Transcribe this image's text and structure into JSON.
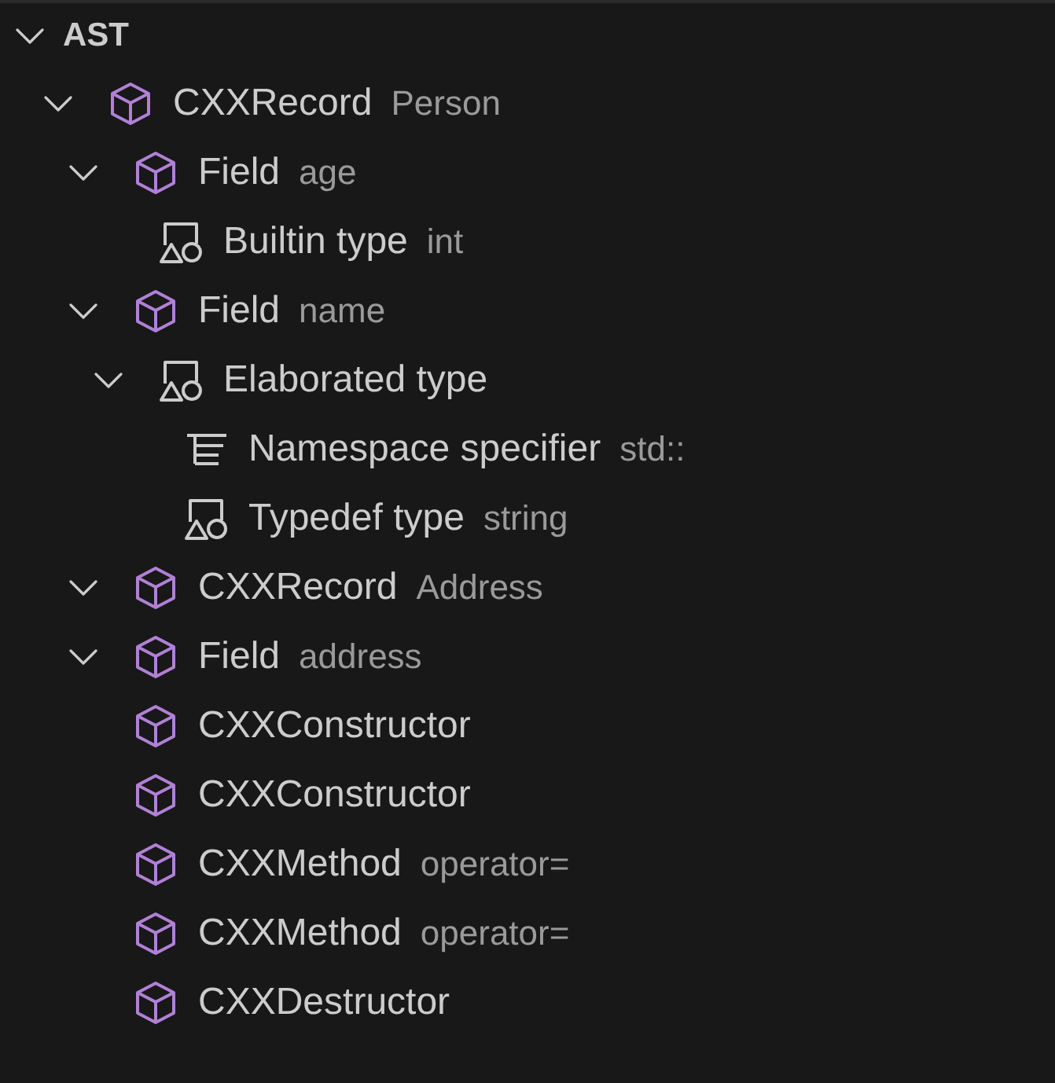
{
  "panel": {
    "title": "AST",
    "expanded": true
  },
  "nodes": [
    {
      "kind": "cube",
      "label": "CXXRecord",
      "detail": "Person",
      "expanded": true,
      "children": [
        {
          "kind": "cube",
          "label": "Field",
          "detail": "age",
          "expanded": true,
          "children": [
            {
              "kind": "shapes",
              "label": "Builtin type",
              "detail": "int"
            }
          ]
        },
        {
          "kind": "cube",
          "label": "Field",
          "detail": "name",
          "expanded": true,
          "children": [
            {
              "kind": "shapes",
              "label": "Elaborated type",
              "expanded": true,
              "children": [
                {
                  "kind": "list",
                  "label": "Namespace specifier",
                  "detail": "std::"
                },
                {
                  "kind": "shapes",
                  "label": "Typedef type",
                  "detail": "string"
                }
              ]
            }
          ]
        },
        {
          "kind": "cube",
          "label": "CXXRecord",
          "detail": "Address",
          "expanded": true
        },
        {
          "kind": "cube",
          "label": "Field",
          "detail": "address",
          "expanded": true
        },
        {
          "kind": "cube",
          "label": "CXXConstructor"
        },
        {
          "kind": "cube",
          "label": "CXXConstructor"
        },
        {
          "kind": "cube",
          "label": "CXXMethod",
          "detail": "operator="
        },
        {
          "kind": "cube",
          "label": "CXXMethod",
          "detail": "operator="
        },
        {
          "kind": "cube",
          "label": "CXXDestructor"
        }
      ]
    }
  ]
}
